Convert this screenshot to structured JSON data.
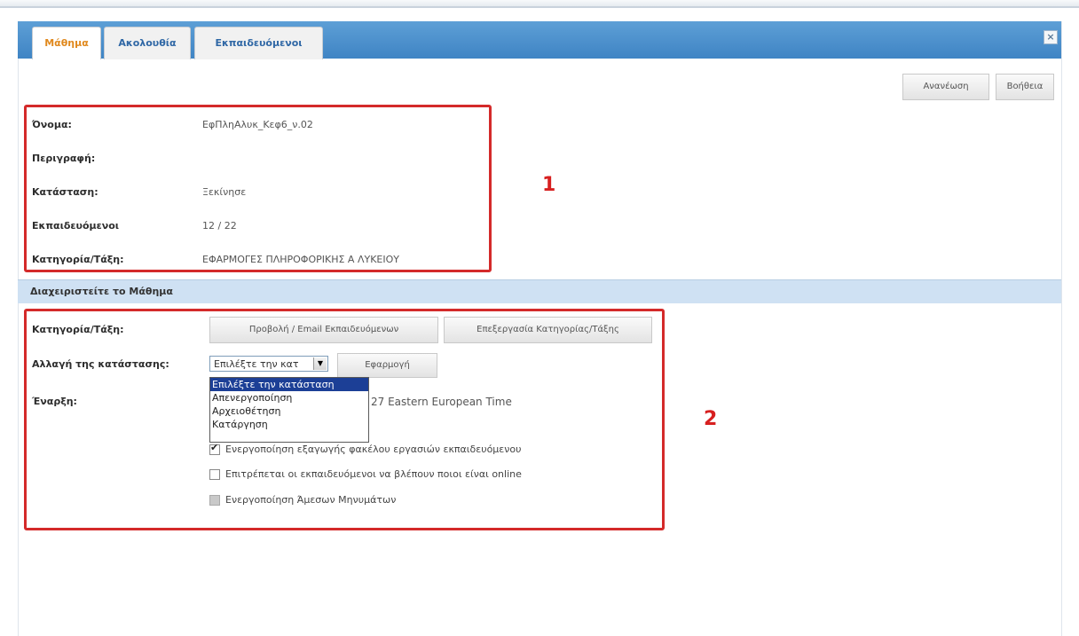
{
  "tabs": [
    {
      "label": "Μάθημα",
      "active": true
    },
    {
      "label": "Ακολουθία",
      "active": false
    },
    {
      "label": "Εκπαιδευόμενοι",
      "active": false
    }
  ],
  "close_icon": "×",
  "toolbar": {
    "refresh_label": "Ανανέωση",
    "help_label": "Βοήθεια"
  },
  "info": [
    {
      "label": "Όνομα:",
      "value": "ΕφΠληΑλυκ_Κεφ6_ν.02"
    },
    {
      "label": "Περιγραφή:",
      "value": ""
    },
    {
      "label": "Κατάσταση:",
      "value": "Ξεκίνησε"
    },
    {
      "label": "Εκπαιδευόμενοι",
      "value": "12 / 22"
    },
    {
      "label": "Κατηγορία/Τάξη:",
      "value": "ΕΦΑΡΜΟΓΕΣ ΠΛΗΡΟΦΟΡΙΚΗΣ Α ΛΥΚΕΙΟΥ"
    }
  ],
  "callouts": {
    "one": "1",
    "two": "2"
  },
  "manage": {
    "title": "Διαχειριστείτε το Μάθημα",
    "category_label": "Κατηγορία/Τάξη:",
    "view_email_button": "Προβολή / Email Εκπαιδευόμενων",
    "edit_category_button": "Επεξεργασία Κατηγορίας/Τάξης",
    "status_change_label": "Αλλαγή της κατάστασης:",
    "select_value": "Επιλέξτε την κατ",
    "apply_button": "Εφαρμογή",
    "dropdown_options": [
      "Επιλέξτε την κατάσταση",
      "Απενεργοποίηση",
      "Αρχειοθέτηση",
      "Κατάργηση"
    ],
    "start_label": "Έναρξη:",
    "start_value_suffix": "27 Eastern European Time",
    "checkboxes": [
      {
        "label": "Ενεργοποίηση εξαγωγής φακέλου εργασιών εκπαιδευόμενου",
        "checked": true,
        "disabled": false
      },
      {
        "label": "Επιτρέπεται οι εκπαιδευόμενοι να βλέπουν ποιοι είναι online",
        "checked": false,
        "disabled": false
      },
      {
        "label": "Ενεργοποίηση Άμεσων Μηνυμάτων",
        "checked": false,
        "disabled": true
      }
    ]
  }
}
